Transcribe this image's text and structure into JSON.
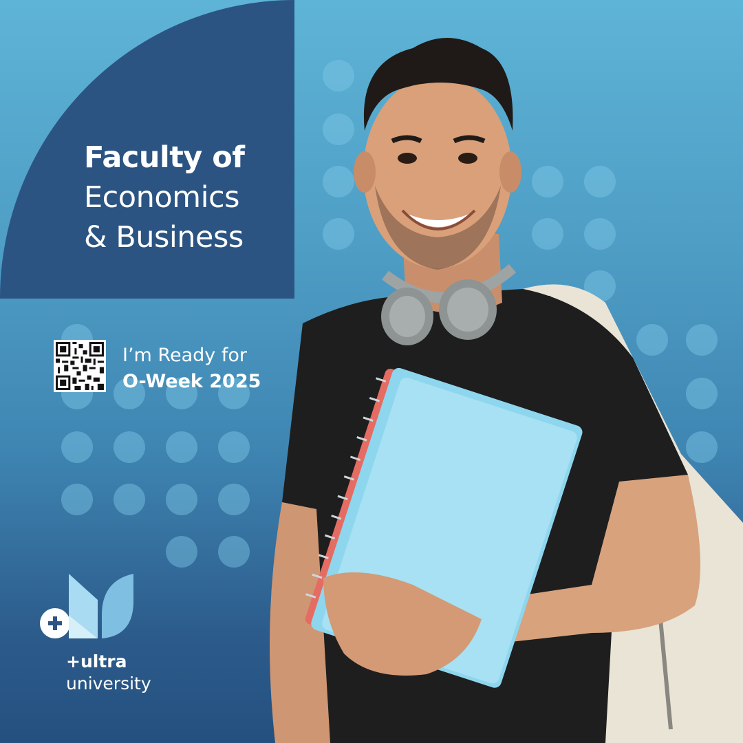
{
  "headline": {
    "line1": "Faculty of",
    "line2": "Economics",
    "line3": "& Business"
  },
  "cta": {
    "line1": "I’m Ready for",
    "line2": "O-Week 2025"
  },
  "brand": {
    "line1": "+ultra",
    "line2": "university"
  },
  "icons": [
    "qr-code-icon",
    "plus-icon",
    "ultra-university-logo"
  ],
  "colors": {
    "navy_panel": "#2b5482",
    "sky_top": "#5eb4d6",
    "deep_bottom": "#24507f",
    "dot": "#7fc8e6",
    "notebook": "#8ed6ee"
  }
}
